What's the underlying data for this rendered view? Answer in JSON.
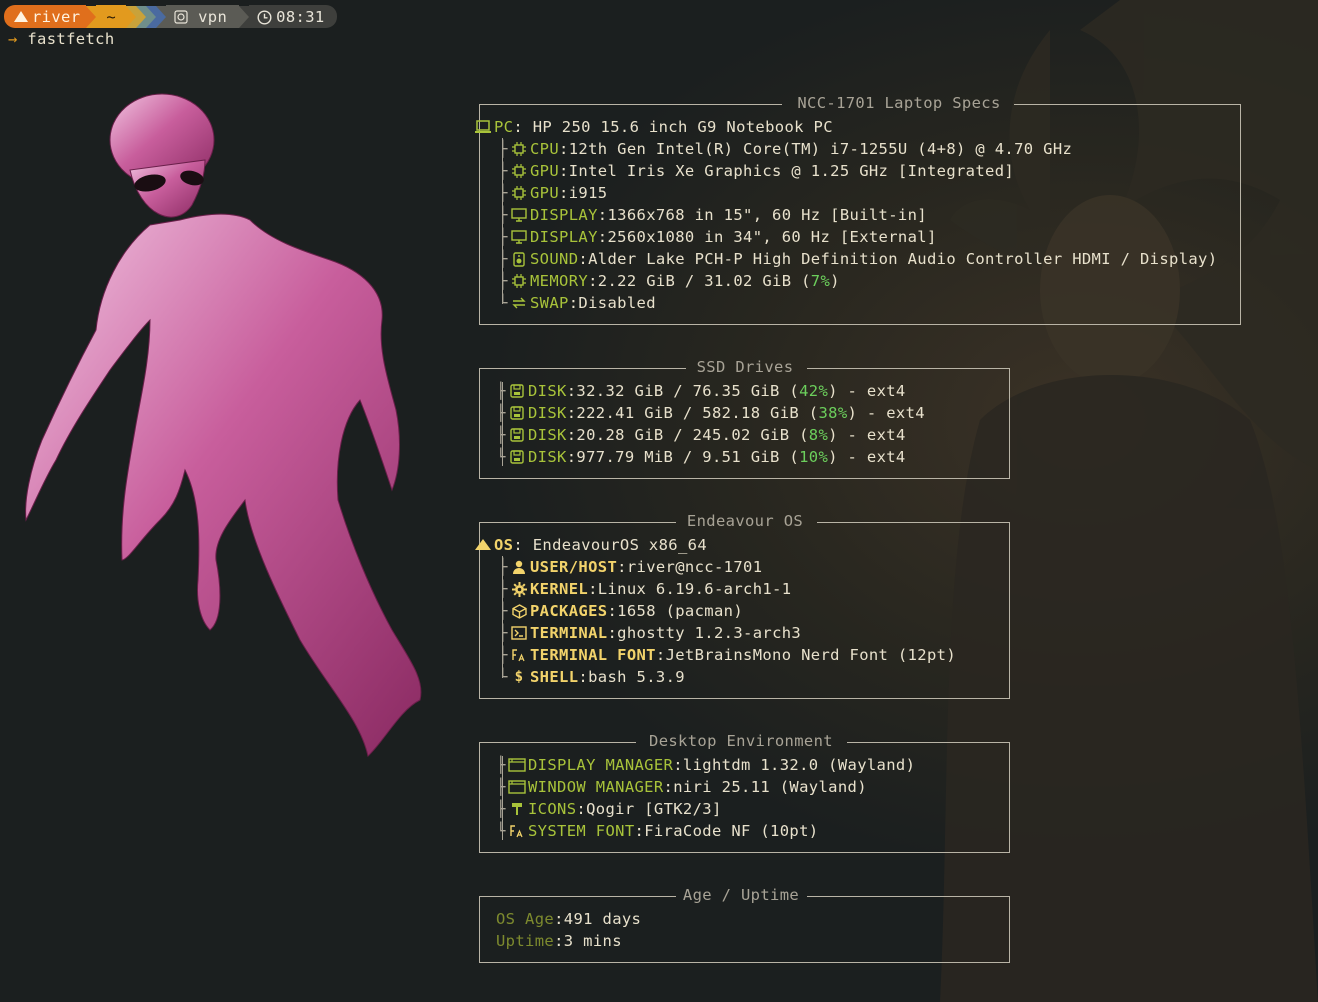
{
  "prompt": {
    "user": "river",
    "dir": "~",
    "vpn": "vpn",
    "time": "08:31",
    "command": "fastfetch",
    "arrow": "→"
  },
  "colors": {
    "green_key": "#a8c33a",
    "yellow_key": "#f2d36b",
    "olive_key": "#7d8a2e",
    "percent": "#6ccf5c",
    "orange_segment": "#e06f1c"
  },
  "specs": {
    "title": "NCC-1701 Laptop Specs",
    "pc": {
      "key": "PC",
      "value": "HP 250 15.6 inch G9 Notebook PC",
      "icon": "laptop-icon"
    },
    "rows": [
      {
        "key": "CPU",
        "value": "12th Gen Intel(R) Core(TM) i7-1255U (4+8) @ 4.70 GHz",
        "icon": "chip-icon"
      },
      {
        "key": "GPU",
        "value": "Intel Iris Xe Graphics @ 1.25 GHz [Integrated]",
        "icon": "chip-icon"
      },
      {
        "key": "GPU",
        "value": "i915",
        "icon": "chip-icon"
      },
      {
        "key": "DISPLAY",
        "value": "1366x768 in 15\", 60 Hz [Built-in]",
        "icon": "monitor-icon"
      },
      {
        "key": "DISPLAY",
        "value": "2560x1080 in 34\", 60 Hz [External]",
        "icon": "monitor-icon"
      },
      {
        "key": "SOUND",
        "value": "Alder Lake PCH-P High Definition Audio Controller HDMI / Display)",
        "icon": "speaker-icon"
      },
      {
        "key": "MEMORY",
        "value_pre": "2.22 GiB / 31.02 GiB (",
        "pct": "7%",
        "value_post": ")",
        "icon": "chip-icon"
      },
      {
        "key": "SWAP",
        "value": "Disabled",
        "icon": "swap-icon"
      }
    ]
  },
  "ssd": {
    "title": "SSD Drives",
    "rows": [
      {
        "key": "DISK",
        "pre": "32.32 GiB / 76.35 GiB (",
        "pct": "42%",
        "post": ") - ext4"
      },
      {
        "key": "DISK",
        "pre": "222.41 GiB / 582.18 GiB (",
        "pct": "38%",
        "post": ") - ext4"
      },
      {
        "key": "DISK",
        "pre": "20.28 GiB / 245.02 GiB (",
        "pct": "8%",
        "post": ") - ext4"
      },
      {
        "key": "DISK",
        "pre": "977.79 MiB / 9.51 GiB (",
        "pct": "10%",
        "post": ") - ext4"
      }
    ]
  },
  "os": {
    "title": "Endeavour OS",
    "os": {
      "key": "OS",
      "value": "EndeavourOS x86_64"
    },
    "rows": [
      {
        "key": "USER/HOST",
        "value": "river@ncc-1701",
        "icon": "user-icon"
      },
      {
        "key": "KERNEL",
        "value": "Linux 6.19.6-arch1-1",
        "icon": "gear-icon"
      },
      {
        "key": "PACKAGES",
        "value": "1658 (pacman)",
        "icon": "package-icon"
      },
      {
        "key": "TERMINAL",
        "value": "ghostty 1.2.3-arch3",
        "icon": "terminal-icon"
      },
      {
        "key": "TERMINAL FONT",
        "value": "JetBrainsMono Nerd Font (12pt)",
        "icon": "font-icon"
      },
      {
        "key": "SHELL",
        "value": "bash 5.3.9",
        "icon": "dollar-icon"
      }
    ]
  },
  "de": {
    "title": "Desktop Environment",
    "rows": [
      {
        "key": "DISPLAY MANAGER",
        "value": "lightdm 1.32.0 (Wayland)",
        "icon": "window-icon"
      },
      {
        "key": "WINDOW MANAGER",
        "value": "niri 25.11 (Wayland)",
        "icon": "window-icon"
      },
      {
        "key": "ICONS",
        "value": "Qogir [GTK2/3]",
        "icon": "brush-icon"
      },
      {
        "key": "SYSTEM FONT",
        "value": "FiraCode NF (10pt)",
        "icon": "font-icon"
      }
    ]
  },
  "age": {
    "title": "Age / Uptime",
    "rows": [
      {
        "key": "OS Age",
        "sep": ":",
        "value": "491 days"
      },
      {
        "key": "Uptime",
        "sep": ":",
        "value": "3 mins"
      }
    ]
  }
}
